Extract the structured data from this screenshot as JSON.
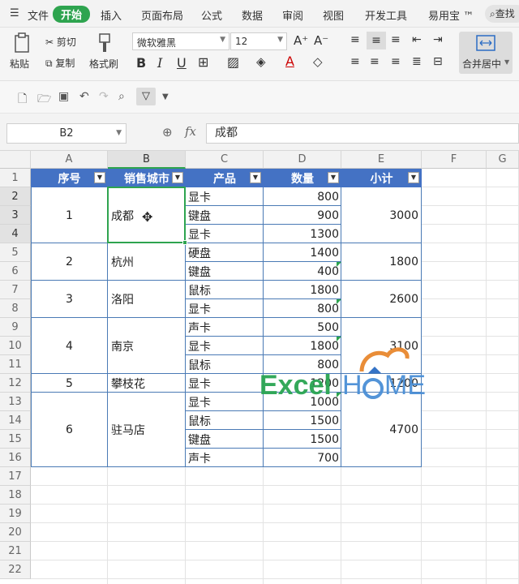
{
  "menu": {
    "file_label": "文件",
    "tabs": [
      "开始",
      "插入",
      "页面布局",
      "公式",
      "数据",
      "审阅",
      "视图",
      "开发工具",
      "易用宝 ™"
    ],
    "search_label": "查找"
  },
  "ribbon": {
    "paste": "粘贴",
    "cut": "剪切",
    "copy": "复制",
    "format_painter": "格式刷",
    "font_name": "微软雅黑",
    "font_size": "12",
    "merge_center": "合并居中"
  },
  "formula_bar": {
    "cell_ref": "B2",
    "fx": "fx",
    "value": "成都"
  },
  "column_headers": [
    "A",
    "B",
    "C",
    "D",
    "E",
    "F",
    "G"
  ],
  "row_numbers": [
    "1",
    "2",
    "3",
    "4",
    "5",
    "6",
    "7",
    "8",
    "9",
    "10",
    "11",
    "12",
    "13",
    "14",
    "15",
    "16",
    "17",
    "18",
    "19",
    "20",
    "21",
    "22"
  ],
  "table": {
    "headers": [
      "序号",
      "销售城市",
      "产品",
      "数量",
      "小计"
    ],
    "groups": [
      {
        "no": "1",
        "city": "成都",
        "subtotal": "3000",
        "items": [
          [
            "显卡",
            "800"
          ],
          [
            "键盘",
            "900"
          ],
          [
            "显卡",
            "1300"
          ]
        ]
      },
      {
        "no": "2",
        "city": "杭州",
        "subtotal": "1800",
        "items": [
          [
            "硬盘",
            "1400"
          ],
          [
            "键盘",
            "400"
          ]
        ]
      },
      {
        "no": "3",
        "city": "洛阳",
        "subtotal": "2600",
        "items": [
          [
            "鼠标",
            "1800"
          ],
          [
            "显卡",
            "800"
          ]
        ]
      },
      {
        "no": "4",
        "city": "南京",
        "subtotal": "3100",
        "items": [
          [
            "声卡",
            "500"
          ],
          [
            "显卡",
            "1800"
          ],
          [
            "鼠标",
            "800"
          ]
        ]
      },
      {
        "no": "5",
        "city": "攀枝花",
        "subtotal": "1200",
        "items": [
          [
            "显卡",
            "1200"
          ]
        ]
      },
      {
        "no": "6",
        "city": "驻马店",
        "subtotal": "4700",
        "items": [
          [
            "显卡",
            "1000"
          ],
          [
            "鼠标",
            "1500"
          ],
          [
            "键盘",
            "1500"
          ],
          [
            "声卡",
            "700"
          ]
        ]
      }
    ]
  },
  "watermark": {
    "text_a": "Excel",
    "text_b": "H",
    "text_c": "ME"
  },
  "colors": {
    "accent": "#2ea44f",
    "header_fill": "#4472c4",
    "table_border": "#4a7ab5"
  }
}
